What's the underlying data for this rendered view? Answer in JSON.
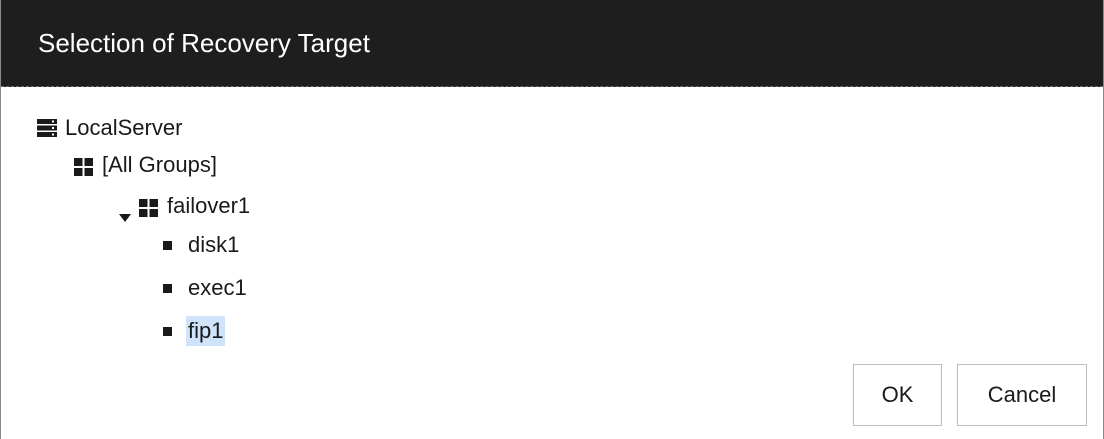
{
  "dialog": {
    "title": "Selection of Recovery Target"
  },
  "tree": {
    "server": {
      "label": "LocalServer",
      "icon": "server-icon"
    },
    "all_groups": {
      "label": "[All Groups]",
      "icon": "group-icon"
    },
    "group": {
      "label": "failover1",
      "icon": "group-icon",
      "expanded": true
    },
    "resources": [
      {
        "label": "disk1",
        "selected": false
      },
      {
        "label": "exec1",
        "selected": false
      },
      {
        "label": "fip1",
        "selected": true
      }
    ]
  },
  "buttons": {
    "ok_label": "OK",
    "cancel_label": "Cancel"
  },
  "colors": {
    "titlebar_bg": "#1e1e1e",
    "selection_bg": "#cfe3fb",
    "text": "#1a1a1a"
  }
}
